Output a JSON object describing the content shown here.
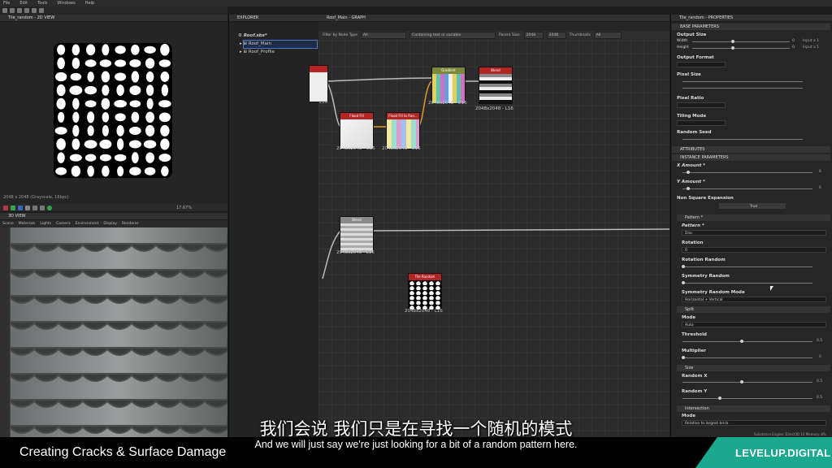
{
  "menu": [
    "File",
    "Edit",
    "Tools",
    "Windows",
    "Help"
  ],
  "view2d": {
    "title": "Tile_random - 2D VIEW",
    "status": "2048 x 2048 (Grayscale, 16bpc)",
    "zoom": "17.67%"
  },
  "view3d": {
    "title": "3D VIEW",
    "menu": [
      "Scene",
      "Materials",
      "Lights",
      "Camera",
      "Environment",
      "Display",
      "Renderer"
    ]
  },
  "explorer": {
    "title": "EXPLORER",
    "package": "Roof.sbs*",
    "items": [
      "Roof_Main",
      "Roof_Profile"
    ]
  },
  "graph": {
    "title": "Roof_Main - GRAPH",
    "filter_label": "Filter by Node Type",
    "filter_value": "All",
    "search_placeholder": "Containing text or variable",
    "parent_size_label": "Parent Size:",
    "parent_size": "2048",
    "size_value": "2048",
    "thumbnails_label": "Thumbnails",
    "thumbnails_value": "All",
    "nodes": [
      {
        "title": "",
        "label": "L16"
      },
      {
        "title": "Flood Fill",
        "label": "2048x2048 - C16"
      },
      {
        "title": "Flood Fill to Ran...",
        "label": "2048x2048 - C16"
      },
      {
        "title": "Gradient",
        "label": "2048x2048 - C16"
      },
      {
        "title": "Blend",
        "label": "2048x2048 - L16"
      },
      {
        "title": "Blend",
        "label": "2048x2048 - L16"
      },
      {
        "title": "Tile Random",
        "label": "2048x2048 - L16"
      }
    ]
  },
  "props": {
    "title": "Tile_random - PROPERTIES",
    "base_section": "BASE PARAMETERS",
    "output_size": "Output Size",
    "width": "Width",
    "height": "Height",
    "width_val": "0",
    "height_val": "0",
    "relative": "Input x 1",
    "output_format": "Output Format",
    "pixel_size": "Pixel Size",
    "pixel_ratio": "Pixel Ratio",
    "tiling_mode": "Tiling Mode",
    "random_seed": "Random Seed",
    "attributes": "ATTRIBUTES",
    "instance_section": "INSTANCE PARAMETERS",
    "x_amount": "X Amount *",
    "x_amount_val": "6",
    "y_amount": "Y Amount *",
    "y_amount_val": "6",
    "non_square": "Non Square Expansion",
    "non_square_val": "True",
    "pattern_group": "Pattern *",
    "pattern": "Pattern *",
    "pattern_val": "Disc",
    "rotation": "Rotation",
    "rotation_val": "0",
    "rotation_random": "Rotation Random",
    "symmetry_random": "Symmetry Random",
    "symmetry_random_mode": "Symmetry Random Mode",
    "symmetry_mode_val": "Horizontal + Vertical",
    "split_group": "Split",
    "mode": "Mode",
    "mode_val": "Auto",
    "threshold": "Threshold",
    "threshold_val": "0.5",
    "multiplier": "Multiplier",
    "multiplier_val": "0",
    "size_group": "Size",
    "random_x": "Random X",
    "random_x_val": "0.5",
    "random_y": "Random Y",
    "random_y_val": "0.5",
    "intersection_group": "Intersection",
    "int_mode": "Mode",
    "int_mode_val": "Relative to largest brick"
  },
  "engine": "Substance Engine: Direct3D 10   Memory: 8%",
  "subtitle_cn": "我们会说 我们只是在寻找一个随机的模式",
  "subtitle_en": "And we will just say we're just looking for a bit of a random pattern here.",
  "course_title": "Creating Cracks & Surface Damage",
  "brand": "LEVELUP.DIGITAL",
  "colors": {
    "accent_orange": "#e8962a",
    "node_red": "#b32424",
    "brand_teal": "#1aa88f",
    "selection_blue": "#4a78c8"
  }
}
